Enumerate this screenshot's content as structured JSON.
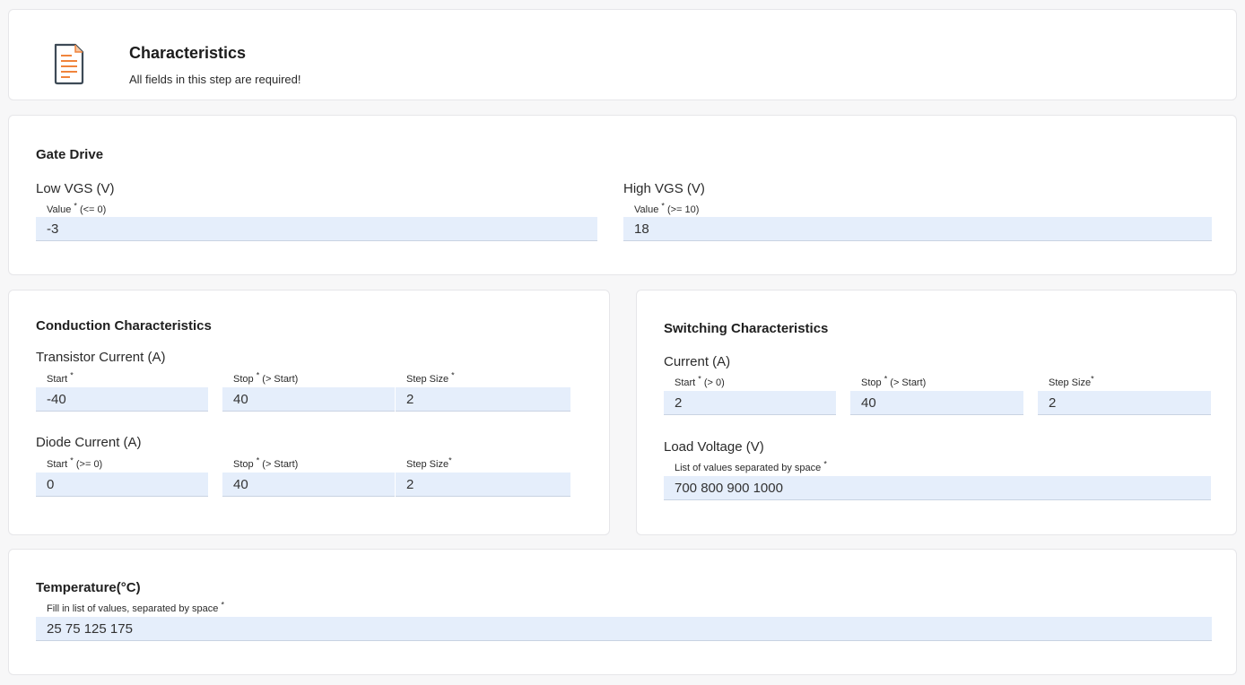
{
  "header": {
    "icon": "document-icon",
    "title": "Characteristics",
    "subtitle": "All fields in this step are required!"
  },
  "gate_drive": {
    "title": "Gate Drive",
    "low_vgs": {
      "label": "Low VGS (V)",
      "field_label": "Value",
      "hint": "(<= 0)",
      "value": "-3"
    },
    "high_vgs": {
      "label": "High VGS (V)",
      "field_label": "Value",
      "hint": "(>= 10)",
      "value": "18"
    }
  },
  "conduction": {
    "title": "Conduction Characteristics",
    "transistor": {
      "label": "Transistor Current (A)",
      "start": {
        "label": "Start",
        "hint": "",
        "value": "-40"
      },
      "stop": {
        "label": "Stop",
        "hint": "(> Start)",
        "value": "40"
      },
      "step": {
        "label": "Step Size",
        "hint": "",
        "value": "2"
      }
    },
    "diode": {
      "label": "Diode Current (A)",
      "start": {
        "label": "Start",
        "hint": "(>= 0)",
        "value": "0"
      },
      "stop": {
        "label": "Stop",
        "hint": "(> Start)",
        "value": "40"
      },
      "step": {
        "label": "Step Size",
        "hint": "",
        "value": "2"
      }
    }
  },
  "switching": {
    "title": "Switching Characteristics",
    "current": {
      "label": "Current (A)",
      "start": {
        "label": "Start",
        "hint": "(> 0)",
        "value": "2"
      },
      "stop": {
        "label": "Stop",
        "hint": "(> Start)",
        "value": "40"
      },
      "step": {
        "label": "Step Size",
        "hint": "",
        "value": "2"
      }
    },
    "load_voltage": {
      "label": "Load Voltage (V)",
      "field_label": "List of values separated by space",
      "value": "700 800 900 1000"
    }
  },
  "temperature": {
    "title": "Temperature(°C)",
    "field_label": "Fill in list of values, separated by space",
    "value": "25 75 125 175"
  },
  "required_marker": "*",
  "colors": {
    "input_bg": "#e5eefb",
    "icon_accent": "#f0843c",
    "icon_stroke": "#3d4a56"
  }
}
